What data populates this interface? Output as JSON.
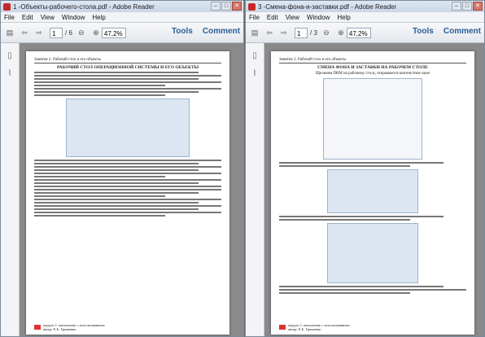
{
  "left_window": {
    "title": "1 -Объекты-рабочего-стола.pdf - Adobe Reader",
    "menus": [
      "File",
      "Edit",
      "View",
      "Window",
      "Help"
    ],
    "page_num": "1",
    "page_total": "/ 6",
    "zoom": "47,2%",
    "tools": "Tools",
    "comment": "Comment",
    "doc": {
      "header": "Занятие 2. Рабочий стол и его объекты",
      "title": "РАБОЧИЙ СТОЛ ОПЕРАЦИОННОЙ СИСТЕМЫ И ЕГО ОБЪЕКТЫ",
      "footer1": "модуль 1. выполнено с использованием",
      "footer2": "автор: Е.Б. Гришенко"
    }
  },
  "right_window": {
    "title": "3 -Смена-фона-и-заставки.pdf - Adobe Reader",
    "menus": [
      "File",
      "Edit",
      "View",
      "Window",
      "Help"
    ],
    "page_num": "1",
    "page_total": "/ 3",
    "zoom": "47,2%",
    "tools": "Tools",
    "comment": "Comment",
    "doc": {
      "header": "Занятие 2. Рабочий стол и его объекты",
      "title": "СМЕНА ФОНА И ЗАСТАВКИ НА РАБОЧЕМ СТОЛЕ",
      "subtitle": "Щелкнем ПКМ на рабочему столу, открывается контекстное окно",
      "footer1": "модуль 1. выполнено с использованием",
      "footer2": "автор: Е.Б. Гришенко"
    }
  }
}
